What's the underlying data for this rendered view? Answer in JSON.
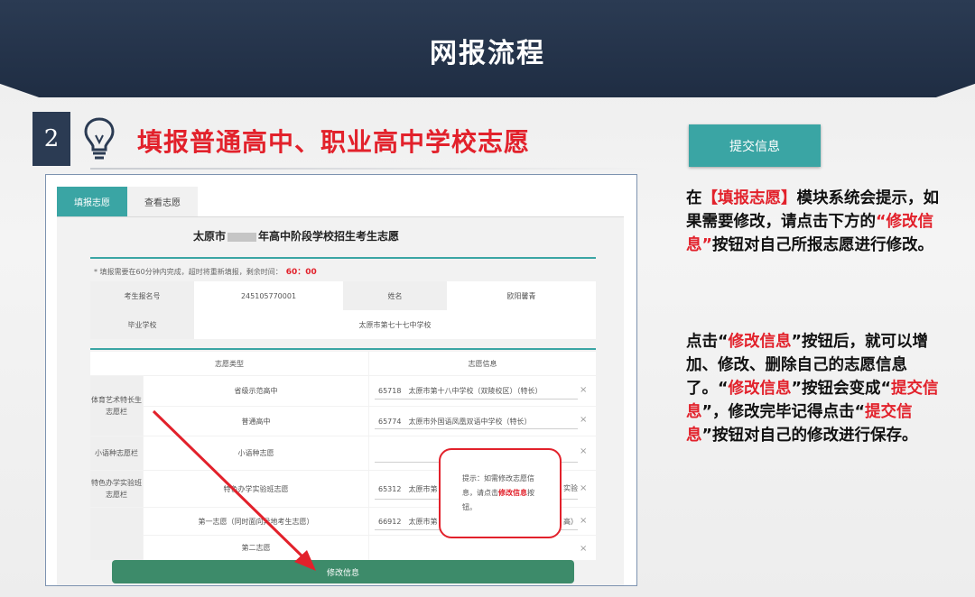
{
  "header": {
    "title": "网报流程"
  },
  "step": {
    "number": "2",
    "title": "填报普通高中、职业高中学校志愿"
  },
  "screenshot": {
    "tabs": [
      {
        "label": "填报志愿",
        "active": true
      },
      {
        "label": "查看志愿",
        "active": false
      }
    ],
    "form_title_prefix": "太原市",
    "form_title_suffix": "年高中阶段学校招生考生志愿",
    "notice": "* 填报需要在60分钟内完成，超时将重新填报，剩余时间：",
    "timer": "60：00",
    "info": {
      "exam_no_label": "考生报名号",
      "exam_no_value": "245105770001",
      "name_label": "姓名",
      "name_value": "欧阳馨青",
      "school_label": "毕业学校",
      "school_value": "太原市第七十七中学校"
    },
    "table_headers": [
      "志愿类型",
      "志愿信息"
    ],
    "groups": [
      "体育艺术特长生志愿栏",
      "小语种志愿栏",
      "特色办学实验班志愿栏"
    ],
    "rows": [
      {
        "type": "省级示范高中",
        "info": "65718　太原市第十八中学校（双陵校区）（特长）"
      },
      {
        "type": "普通高中",
        "info": "65774　太原市外国语凤凰双语中学校（特长）"
      },
      {
        "type": "小语种志愿",
        "info": ""
      },
      {
        "type": "特色办学实验班志愿",
        "info": "65312　太原市第",
        "info_tail": "实验"
      },
      {
        "type": "第一志愿（同时面向异地考生志愿）",
        "info": "66912　太原市第",
        "info_tail": "高）"
      },
      {
        "type": "第二志愿",
        "info": ""
      }
    ],
    "popup": {
      "text_before": "提示：如需修改志愿信息，请点击",
      "highlight": "修改信息",
      "text_after": "按钮。"
    },
    "modify_button": "修改信息",
    "remove_icon": "×"
  },
  "right": {
    "submit_label": "提交信息",
    "p1": {
      "a": "在",
      "b": "【填报志愿】",
      "c": "模块系统会提示，如果需要修改，请点击下方的",
      "d": "“修改信息”",
      "e": "按钮对自己所报志愿进行修改。"
    },
    "p2": {
      "a": "点击“",
      "b": "修改信息",
      "c": "”按钮后，就可以增加、修改、删除自己的志愿信息了。“",
      "d": "修改信息",
      "e": "”按钮会变成“",
      "f": "提交信息",
      "g": "”，修改完毕记得点击“",
      "h": "提交信息",
      "i": "”按钮对自己的修改进行保存。"
    }
  },
  "colors": {
    "banner": "#2b3b53",
    "accent_red": "#e2212b",
    "teal": "#3aa5a4",
    "button_green": "#3d8b6a"
  },
  "icons": {
    "step": "lightbulb-icon",
    "arrow": "red-arrow-annotation",
    "remove": "close-icon"
  }
}
